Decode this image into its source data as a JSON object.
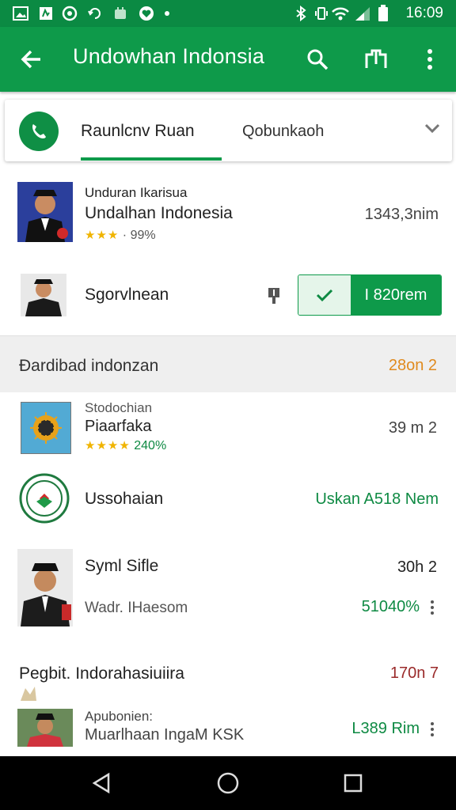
{
  "status_bar": {
    "time": "16:09",
    "icons": [
      "gallery-icon",
      "file-icon",
      "whatsapp-icon",
      "sync-icon",
      "android-icon",
      "heart-icon",
      "dot-icon",
      "bluetooth-icon",
      "vibrate-icon",
      "wifi-icon",
      "signal-icon",
      "battery-icon"
    ]
  },
  "app_bar": {
    "title": "Undowhan Indonsia",
    "icons": [
      "back-arrow-icon",
      "search-icon",
      "bookmark-icon",
      "more-vert-icon"
    ]
  },
  "tabs": {
    "active": "Raunlcnv Ruan",
    "other": "Qobunkaoh"
  },
  "rows": [
    {
      "subtitle": "Unduran Ikarisua",
      "title": "Undalhan Indonesia",
      "rating": "· 99%",
      "value": "1343,3nim"
    },
    {
      "title": "Sgorvlnean",
      "button_value": "I 820rem"
    },
    {
      "section": "Đardibad indonzan",
      "section_value": "28on  2"
    },
    {
      "subtitle": "Stodochian",
      "title": "Piaarfaka",
      "rating": "240%",
      "value": "39 m 2"
    },
    {
      "title": "Ussohaian",
      "value": "Uskan A518 Nem"
    },
    {
      "title": "Syml Sifle",
      "subtitle": "Wadr. IHaesom",
      "value": "30h 2",
      "value2": "51040%"
    },
    {
      "title": "Pegbit. Indorahasiuiira",
      "value": "170n 7"
    },
    {
      "subtitle": "Apubonien:",
      "title": "Muarlhaan IngaM KSK",
      "value": "L389 Rim"
    }
  ],
  "colors": {
    "primary": "#0e9a4a",
    "status": "#0b8a43",
    "accent_orange": "#e08a1e",
    "accent_red": "#9a2a2a"
  }
}
